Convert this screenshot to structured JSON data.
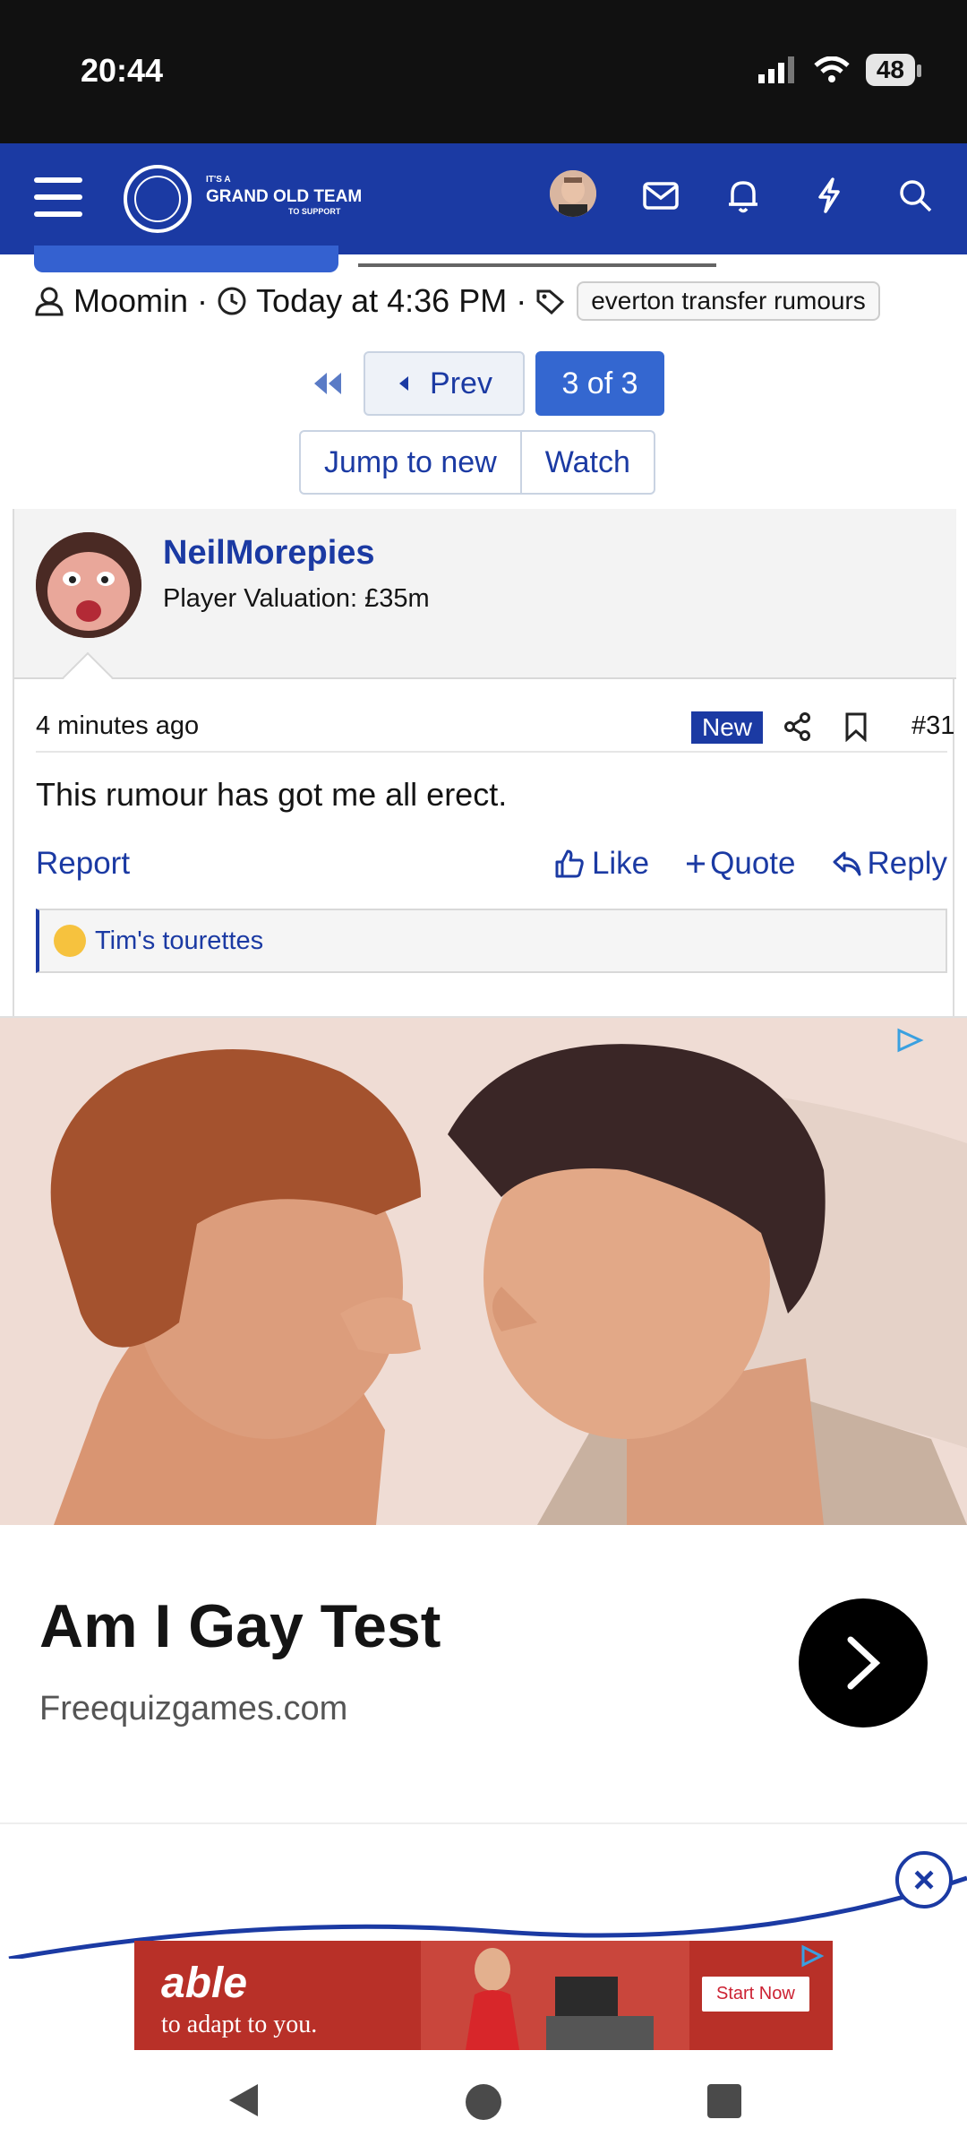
{
  "status_bar": {
    "time": "20:44",
    "battery": "48",
    "icons": [
      "signal-icon",
      "wifi-icon",
      "battery-icon"
    ]
  },
  "header": {
    "brand_small_top": "IT'S A",
    "brand_main": "GRAND OLD TEAM",
    "brand_small_bottom": "TO SUPPORT",
    "icons": [
      "menu-icon",
      "inbox-icon",
      "bell-icon",
      "lightning-icon",
      "search-icon"
    ],
    "accent_color": "#1b3aa3"
  },
  "thread": {
    "author": "Moomin",
    "date": "Today at 4:36 PM",
    "tag": "everton transfer rumours"
  },
  "pagination": {
    "prev_label": "Prev",
    "current": "3 of 3"
  },
  "thread_actions": {
    "jump_label": "Jump to new",
    "watch_label": "Watch"
  },
  "post": {
    "username": "NeilMorepies",
    "user_title": "Player Valuation: £35m",
    "time_ago": "4 minutes ago",
    "new_badge": "New",
    "post_number": "#31",
    "body": "This rumour has got me all erect.",
    "report_label": "Report",
    "like_label": "Like",
    "quote_label": "Quote",
    "reply_label": "Reply",
    "reaction_text": "Tim's tourettes"
  },
  "ad": {
    "title": "Am I Gay Test",
    "url": "Freequizgames.com"
  },
  "banner_ad": {
    "headline": "able",
    "subline": "to adapt to you.",
    "cta": "Start Now"
  }
}
